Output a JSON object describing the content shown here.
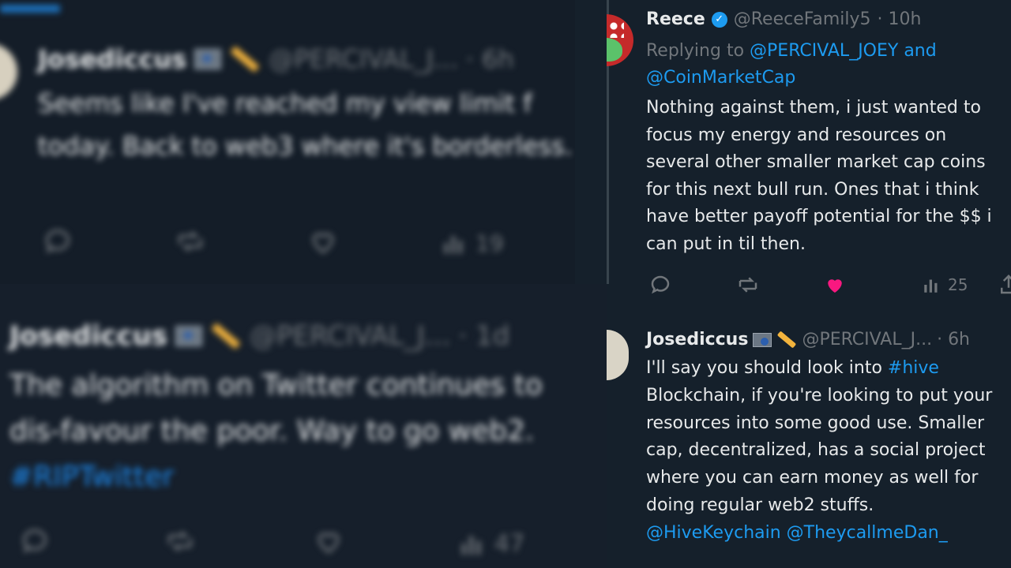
{
  "left_top": {
    "name": "Josediccus",
    "handle": "@PERCIVAL_J...",
    "time": "· 6h",
    "body": "Seems like I've reached my view limit f today. Back to web3 where it's borderless.",
    "views": "19"
  },
  "left_bottom": {
    "name": "Josediccus",
    "handle": "@PERCIVAL_J...",
    "time": "· 1d",
    "body_line1": "The algorithm on Twitter continues to",
    "body_line2": "dis-favour the poor. Way to go web2.",
    "hashtag": "#RIPTwitter",
    "views": "47"
  },
  "right": {
    "reply": {
      "name": "Reece",
      "handle": "@ReeceFamily5",
      "time": "· 10h",
      "replying_prefix": "Replying to",
      "replying_to_1": "@PERCIVAL_JOEY and",
      "replying_to_2": "@CoinMarketCap",
      "lines": [
        "Nothing against them, i just wanted to",
        "focus my energy and resources on",
        "several other smaller market cap coins",
        "for this next bull run. Ones that i think",
        "have better payoff potential for the $$ i",
        "can put in til then."
      ],
      "views": "25"
    },
    "jose": {
      "name": "Josediccus",
      "handle": "@PERCIVAL_J...",
      "time": "· 6h",
      "line1_prefix": "I'll say you should look into",
      "line1_hashtag": "#hive",
      "lines": [
        "Blockchain, if you're looking to put your",
        "resources into some good use. Smaller",
        "cap, decentralized, has a social project",
        "where you can earn money as well for",
        "doing regular web2 stuffs."
      ],
      "mention1": "@HiveKeychain",
      "mention2": "@TheycallmeDan_"
    }
  },
  "icons": {
    "reply": "reply-icon",
    "retweet": "retweet-icon",
    "like": "like-icon",
    "views": "views-icon",
    "share": "share-icon",
    "verified": "verified-badge"
  },
  "colors": {
    "background": "#15202b",
    "accent": "#1d9bf0",
    "like": "#f91880",
    "muted": "#71767b"
  }
}
